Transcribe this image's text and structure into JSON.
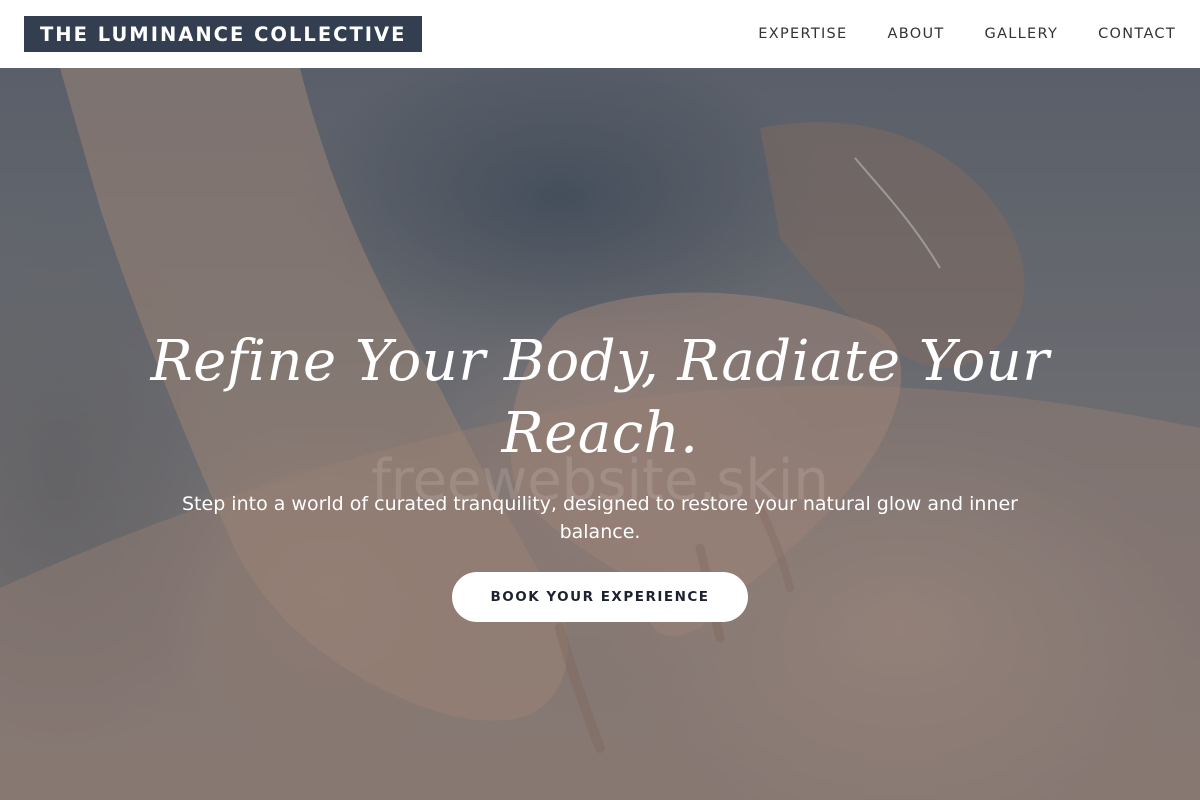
{
  "header": {
    "logo": "THE LUMINANCE COLLECTIVE",
    "nav": [
      {
        "label": "EXPERTISE"
      },
      {
        "label": "ABOUT"
      },
      {
        "label": "GALLERY"
      },
      {
        "label": "CONTACT"
      }
    ]
  },
  "hero": {
    "headline_line1": "Refine Your Body, Radiate Your",
    "headline_line2": "Reach.",
    "watermark": "freewebsite.skin",
    "subtext": "Step into a world of curated tranquility, designed to restore your natural glow and inner balance.",
    "cta_label": "BOOK YOUR EXPERIENCE"
  },
  "colors": {
    "logo_background": "#333e50",
    "header_background": "#ffffff",
    "cta_background": "#ffffff",
    "cta_text": "#1e2230"
  }
}
